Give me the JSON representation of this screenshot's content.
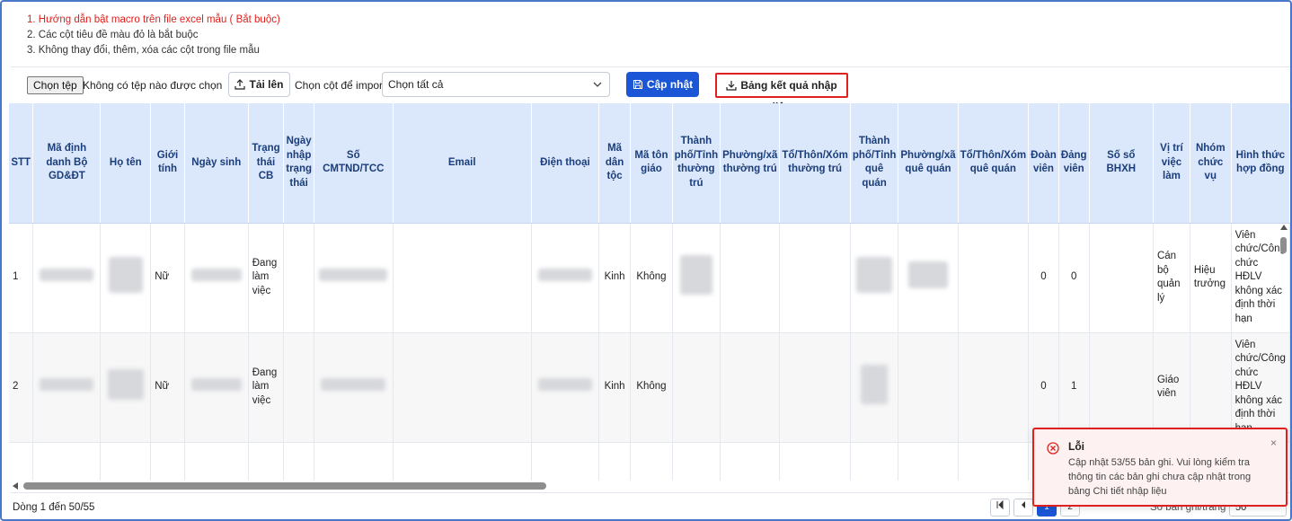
{
  "instructions": [
    "1. Hướng dẫn bật macro trên file excel mẫu ( Bắt buộc)",
    "2. Các cột tiêu đề màu đỏ là bắt buộc",
    "3. Không thay đổi, thêm, xóa các cột trong file mẫu"
  ],
  "toolbar": {
    "choose_file_label": "Chọn tệp",
    "no_file_text": "Không có tệp nào được chọn",
    "upload_label": "Tải lên",
    "import_column_label": "Chọn cột để import",
    "import_select_value": "Chọn tất cả",
    "update_label": "Cập nhật",
    "result_label": "Bảng kết quả nhập liệu"
  },
  "table": {
    "headers": [
      "STT",
      "Mã định danh Bộ GD&ĐT",
      "Họ tên",
      "Giới tính",
      "Ngày sinh",
      "Trạng thái CB",
      "Ngày nhập trạng thái",
      "Số CMTND/TCC",
      "Email",
      "Điện thoại",
      "Mã dân tộc",
      "Mã tôn giáo",
      "Thành phố/Tỉnh thường trú",
      "Phường/xã thường trú",
      "Tổ/Thôn/Xóm thường trú",
      "Thành phố/Tỉnh quê quán",
      "Phường/xã quê quán",
      "Tổ/Thôn/Xóm quê quán",
      "Đoàn viên",
      "Đảng viên",
      "Số sổ BHXH",
      "Vị trí việc làm",
      "Nhóm chức vụ",
      "Hình thức hợp đồng"
    ],
    "rows": [
      {
        "stt": "1",
        "gender": "Nữ",
        "status": "Đang làm việc",
        "ethnicity": "Kinh",
        "religion": "Không",
        "doan_vien": "0",
        "dang_vien": "0",
        "position": "Cán bộ quản lý",
        "role_group": "Hiệu trưởng",
        "contract": "Viên chức/Công chức HĐLV không xác định thời hạn"
      },
      {
        "stt": "2",
        "gender": "Nữ",
        "status": "Đang làm việc",
        "ethnicity": "Kinh",
        "religion": "Không",
        "doan_vien": "0",
        "dang_vien": "1",
        "position": "Giáo viên",
        "role_group": "",
        "contract": "Viên chức/Công chức HĐLV không xác định thời hạn"
      }
    ]
  },
  "footer": {
    "row_info": "Dòng 1 đến 50/55",
    "pages": [
      "1",
      "2"
    ],
    "per_page_label": "Số bản ghi/trang",
    "per_page_value": "50"
  },
  "toast": {
    "title": "Lỗi",
    "message": "Cập nhật 53/55 bản ghi. Vui lòng kiểm tra thông tin các bản ghi chưa cập nhật trong bảng Chi tiết nhập liệu",
    "close": "×"
  },
  "colors": {
    "primary": "#1a56d6",
    "danger": "#e0201c",
    "header_bg": "#dbe7fb",
    "header_text": "#1b3e7a"
  }
}
